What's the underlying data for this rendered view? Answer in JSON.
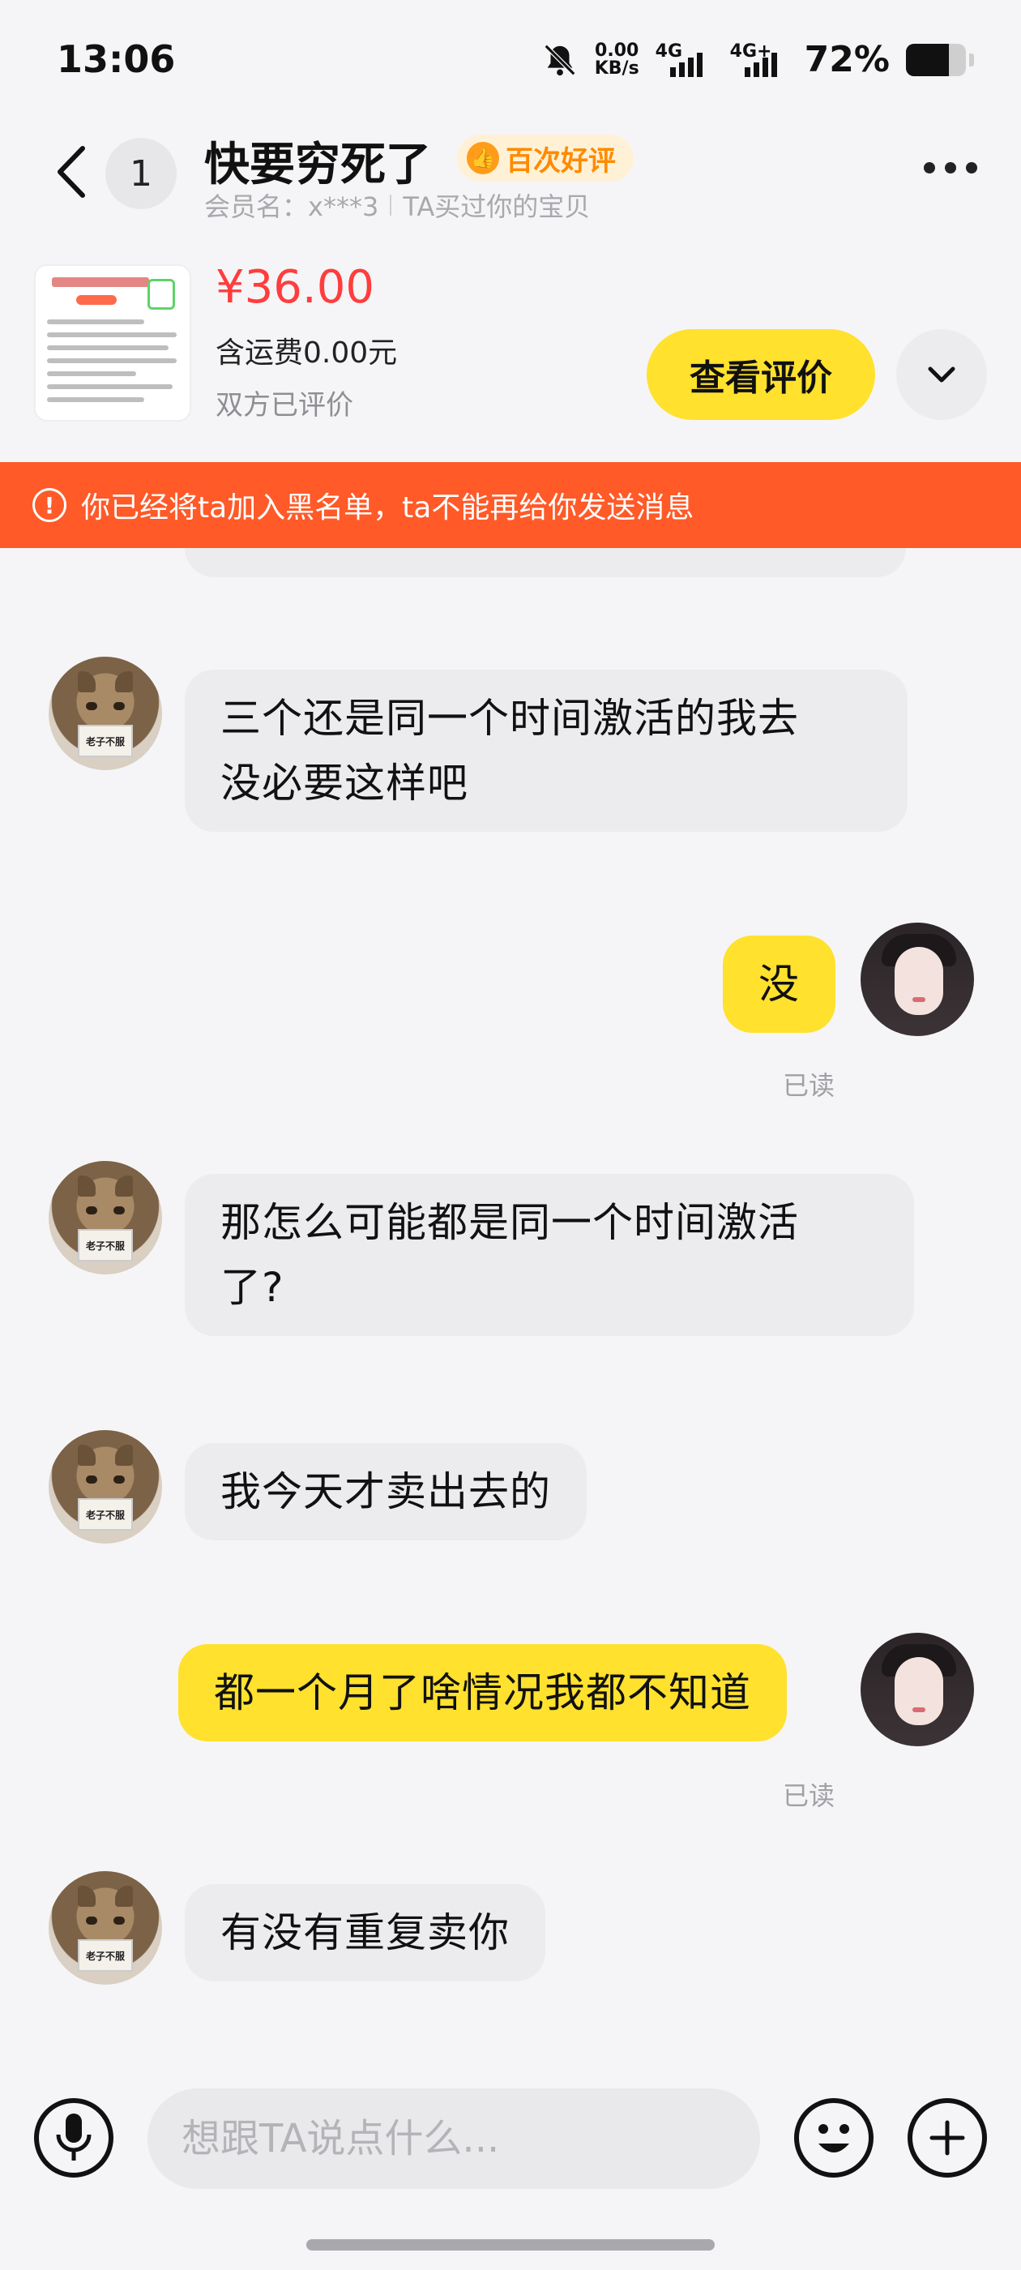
{
  "status_bar": {
    "time": "13:06",
    "net_speed_value": "0.00",
    "net_speed_unit": "KB/s",
    "network_1": "4G",
    "network_2": "4G+",
    "battery_percent": "72%",
    "battery_level": 0.72
  },
  "header": {
    "unread_count": "1",
    "name": "快要穷死了",
    "badge": "百次好评",
    "member": "会员名：x***3",
    "relation": "TA买过你的宝贝"
  },
  "product": {
    "price": "¥36.00",
    "shipping": "含运费0.00元",
    "status": "双方已评价",
    "review_button": "查看评价"
  },
  "blacklist_notice": "你已经将ta加入黑名单，ta不能再给你发送消息",
  "messages": [
    {
      "side": "in",
      "text_line1": "三个还是同一个时间激活的我去",
      "text_line2": "没必要这样吧"
    },
    {
      "side": "out",
      "text": "没",
      "read": "已读"
    },
    {
      "side": "in",
      "text_line1": "那怎么可能都是同一个时间激活",
      "text_line2": "了?"
    },
    {
      "side": "in",
      "text": "我今天才卖出去的"
    },
    {
      "side": "out",
      "text": "都一个月了啥情况我都不知道",
      "read": "已读"
    },
    {
      "side": "in",
      "text": "有没有重复卖你"
    }
  ],
  "avatar_sign_text": "老子不服",
  "input": {
    "placeholder": "想跟TA说点什么..."
  },
  "colors": {
    "accent_yellow": "#ffe12e",
    "banner_orange": "#ff5a28",
    "price_red": "#ff3d3d"
  },
  "icons": {
    "back": "chevron-left-icon",
    "more": "more-dots-icon",
    "expand": "chevron-down-icon",
    "mic": "microphone-icon",
    "emoji": "smiley-icon",
    "plus": "plus-icon",
    "warning": "warning-circle-icon",
    "mute": "bell-off-icon"
  }
}
